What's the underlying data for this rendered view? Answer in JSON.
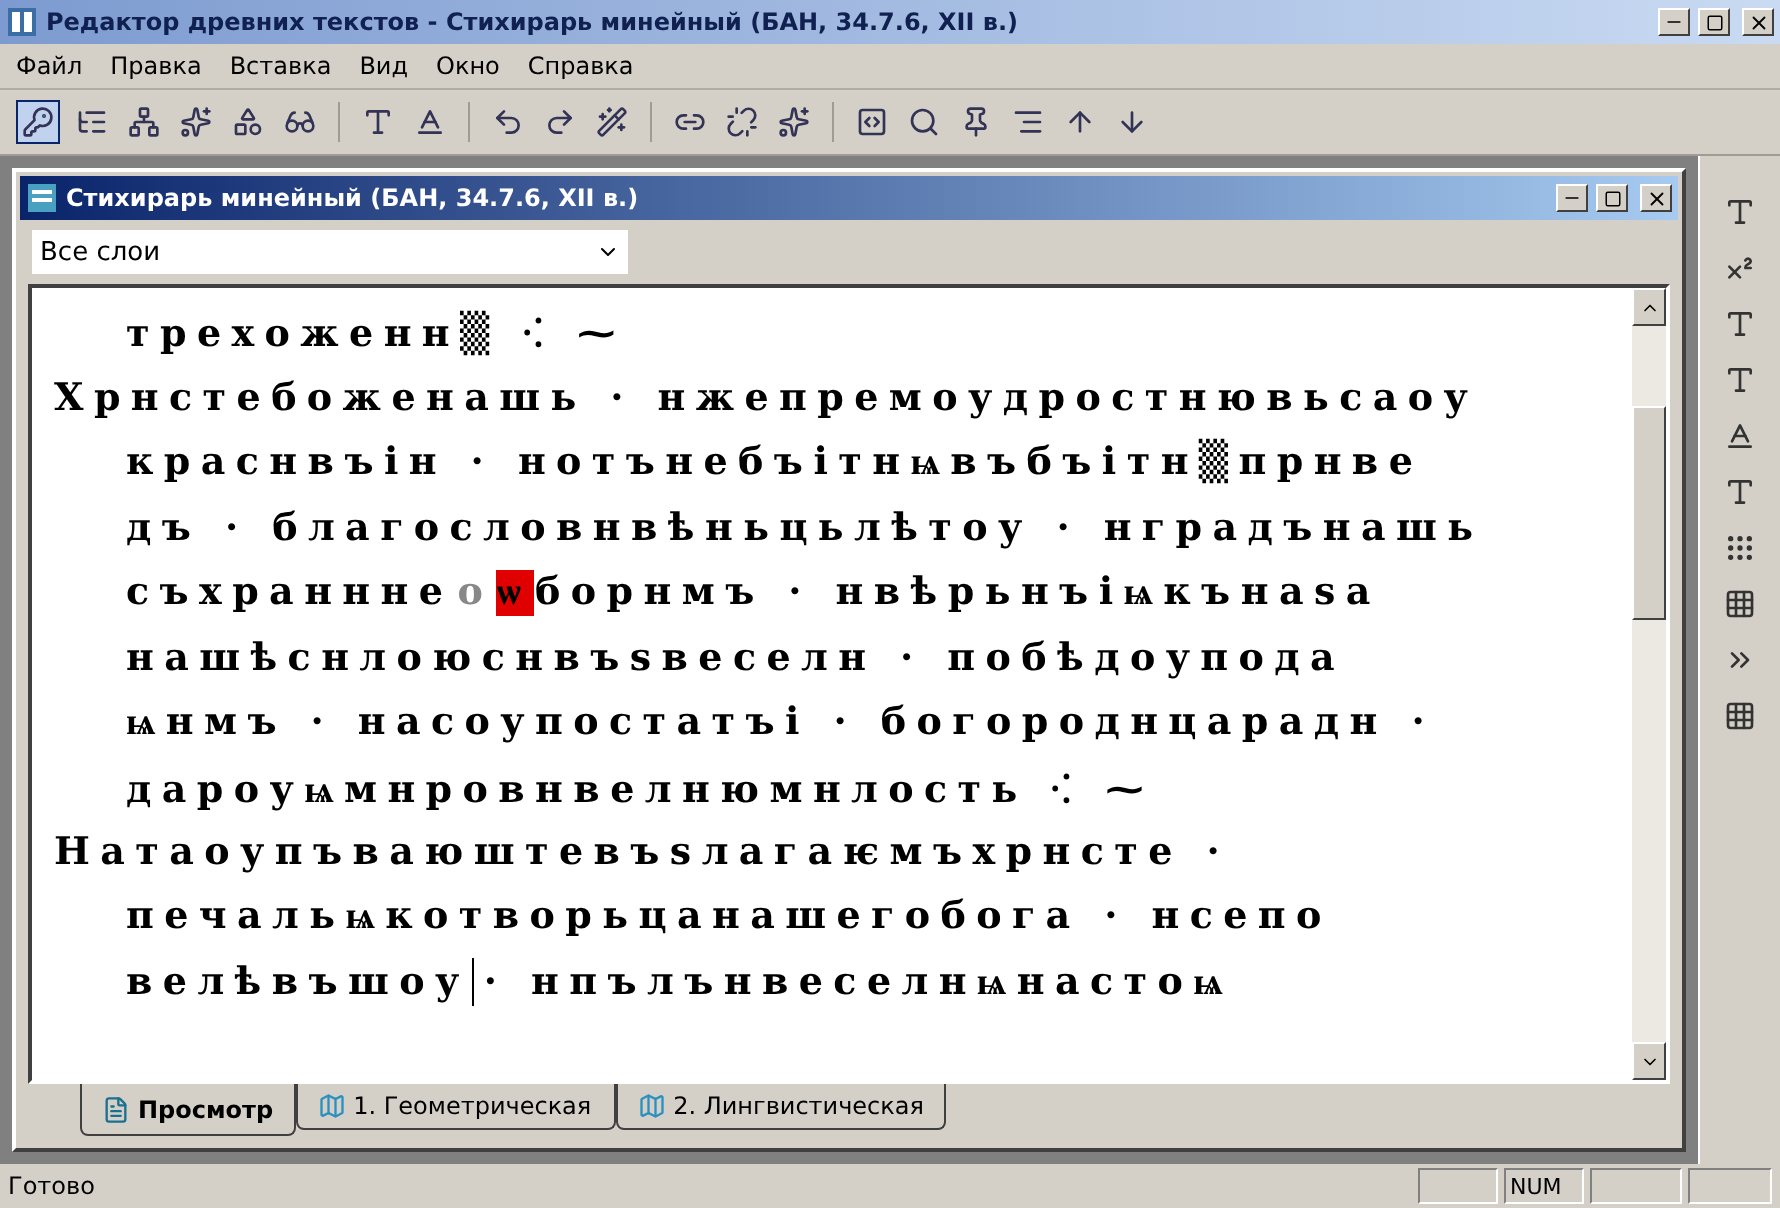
{
  "window": {
    "title": "Редактор древних текстов - Стихирарь минейный (БАН, 34.7.6, XII в.)"
  },
  "menu": [
    "Файл",
    "Правка",
    "Вставка",
    "Вид",
    "Окно",
    "Справка"
  ],
  "document": {
    "title": "Стихирарь минейный (БАН, 34.7.6, XII в.)",
    "layer_select": {
      "value": "Все слои"
    },
    "lines": [
      {
        "indent": true,
        "segments": [
          {
            "kind": "normal",
            "text": "трехоженн▒ ⁖ ⁓"
          }
        ]
      },
      {
        "indent": false,
        "segments": [
          {
            "kind": "normal",
            "text": "Хрнстебоженашь · нжепремоудростнювьсаоу"
          }
        ]
      },
      {
        "indent": true,
        "segments": [
          {
            "kind": "normal",
            "text": "краснвъін · нотънебъітнѩвъбъітн▒прнве"
          }
        ]
      },
      {
        "indent": true,
        "segments": [
          {
            "kind": "normal",
            "text": "дъ · благословнвѣньцьлѣтоу · нградънашь"
          }
        ]
      },
      {
        "indent": true,
        "segments": [
          {
            "kind": "normal",
            "text": "съхраннне"
          },
          {
            "kind": "faded",
            "text": "о"
          },
          {
            "kind": "highlight",
            "text": "ѡ"
          },
          {
            "kind": "normal",
            "text": "борнмъ · нвѣрьнъіѩкънаѕа"
          }
        ]
      },
      {
        "indent": true,
        "segments": [
          {
            "kind": "normal",
            "text": "нашѣснлоюснвъѕвеселн · побѣдоупода"
          }
        ]
      },
      {
        "indent": true,
        "segments": [
          {
            "kind": "normal",
            "text": "ѩнмъ · насоупостатъі · богороднцарадн ·"
          }
        ]
      },
      {
        "indent": true,
        "segments": [
          {
            "kind": "normal",
            "text": "дароуѩмнровнвелнюмнлость ⁖ ⁓"
          }
        ]
      },
      {
        "indent": false,
        "segments": [
          {
            "kind": "normal",
            "text": "Натаоупъваюштевъѕлагаѥмъхрнсте ·"
          }
        ]
      },
      {
        "indent": true,
        "segments": [
          {
            "kind": "normal",
            "text": "печальѩкотворьцанашегобога · нсепо"
          }
        ]
      },
      {
        "indent": true,
        "segments": [
          {
            "kind": "normal",
            "text": "велѣвъшоу",
            "caret": true
          },
          {
            "kind": "normal",
            "text": " · нпълънвеселнѩнастоѩ"
          }
        ]
      }
    ],
    "tabs": [
      {
        "label": "Просмотр",
        "selected": true
      },
      {
        "label": "1. Геометрическая",
        "selected": false
      },
      {
        "label": "2. Лингвистическая",
        "selected": false
      }
    ]
  },
  "status_bar": {
    "text": "Готово",
    "indicators": [
      "NUM"
    ]
  }
}
